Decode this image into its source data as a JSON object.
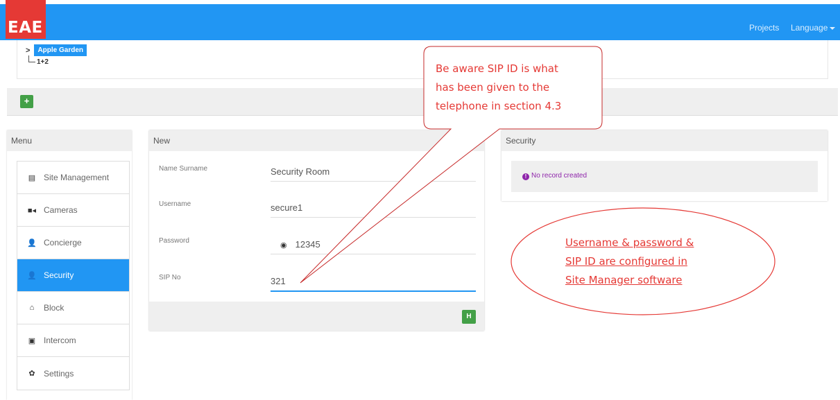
{
  "header": {
    "logo": "EAE",
    "nav": {
      "projects": "Projects",
      "language": "Language"
    },
    "color": "#2196f3",
    "logo_color": "#e53935"
  },
  "tree": {
    "node": "Apple Garden",
    "child": "1+2",
    "add_icon": "+"
  },
  "menu": {
    "title": "Menu",
    "items": [
      {
        "label": "Site Management",
        "icon": "list-icon",
        "glyph": "▤"
      },
      {
        "label": "Cameras",
        "icon": "camera-icon",
        "glyph": "■◂"
      },
      {
        "label": "Concierge",
        "icon": "user-icon",
        "glyph": "👤"
      },
      {
        "label": "Security",
        "icon": "user-icon",
        "glyph": "👤",
        "active": true
      },
      {
        "label": "Block",
        "icon": "home-icon",
        "glyph": "⌂"
      },
      {
        "label": "Intercom",
        "icon": "intercom-icon",
        "glyph": "▣"
      },
      {
        "label": "Settings",
        "icon": "gear-icon",
        "glyph": "✿"
      }
    ]
  },
  "form": {
    "title": "New",
    "fields": [
      {
        "label": "Name Surname",
        "value": "Security Room"
      },
      {
        "label": "Username",
        "value": "secure1"
      },
      {
        "label": "Password",
        "value": "12345",
        "icon": "eye-icon"
      },
      {
        "label": "SIP No",
        "value": "321"
      }
    ],
    "save_icon": "H"
  },
  "security_panel": {
    "title": "Security",
    "message": "No record created",
    "info_glyph": "!"
  },
  "annotations": {
    "callout": [
      "Be aware SIP ID is what",
      "has been given to the",
      "telephone in section 4.3"
    ],
    "ellipse": [
      "Username & password &",
      "SIP ID are configured in",
      "Site Manager software"
    ],
    "color": "#e53935"
  }
}
